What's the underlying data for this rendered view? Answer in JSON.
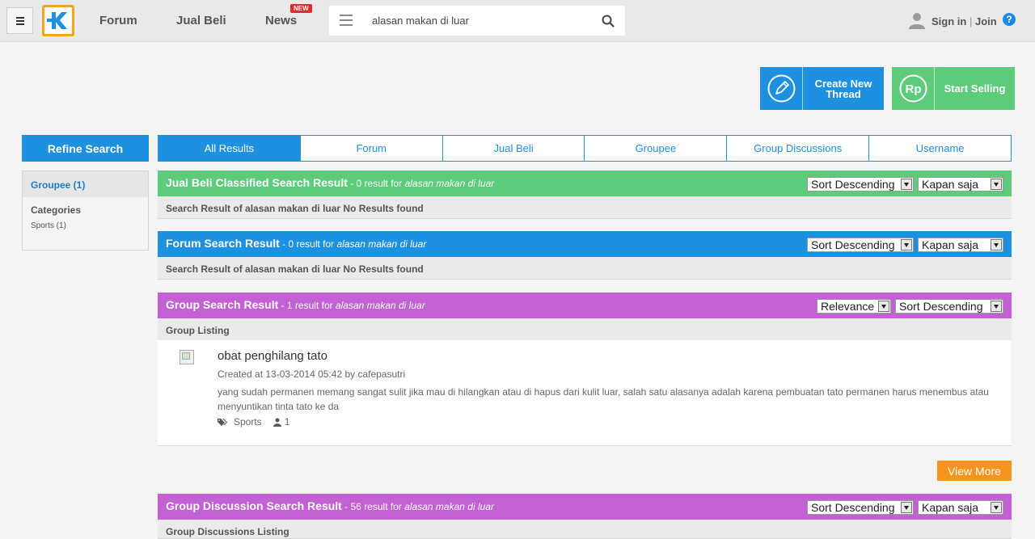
{
  "header": {
    "nav": [
      "Forum",
      "Jual Beli",
      "News"
    ],
    "new_badge": "NEW",
    "search": {
      "value": "alasan makan di luar",
      "placeholder": ""
    },
    "signin": "Sign in",
    "separator": "|",
    "join": "Join",
    "help": "?"
  },
  "actions": {
    "create_line1": "Create New",
    "create_line2": "Thread",
    "sell": "Start Selling",
    "sell_icon_text": "Rp"
  },
  "sidebar": {
    "refine": "Refine Search",
    "groupee": "Groupee (1)",
    "categories": "Categories",
    "sports": "Sports (1)"
  },
  "tabs": [
    "All Results",
    "Forum",
    "Jual Beli",
    "Groupee",
    "Group Discussions",
    "Username"
  ],
  "sections": {
    "jualbeli": {
      "title": "Jual Beli Classified Search Result",
      "count": " - 0 result for ",
      "query": "alasan makan di luar",
      "sort": "Sort Descending",
      "time": "Kapan saja",
      "noresult": "Search Result of alasan makan di luar No Results found"
    },
    "forum": {
      "title": "Forum Search Result",
      "count": " - 0 result for ",
      "query": "alasan makan di luar",
      "sort": "Sort Descending",
      "time": "Kapan saja",
      "noresult": "Search Result of alasan makan di luar No Results found"
    },
    "group": {
      "title": "Group Search Result",
      "count": " - 1 result for ",
      "query": "alasan makan di luar",
      "relevance": "Relevance",
      "sort": "Sort Descending",
      "listing": "Group Listing",
      "item": {
        "title": "obat penghilang tato",
        "meta": "Created at 13-03-2014 05:42 by cafepasutri",
        "desc": "yang sudah permanen memang sangat sulit jika mau di hilangkan atau di hapus dari kulit luar, salah satu alasanya adalah karena pembuatan tato permanen harus menembus atau menyuntikan tinta tato ke da",
        "tag": "Sports",
        "members": "1"
      },
      "viewmore": "View More"
    },
    "groupdisc": {
      "title": "Group Discussion Search Result",
      "count": " - 56 result for ",
      "query": "alasan makan di luar",
      "sort": "Sort Descending",
      "time": "Kapan saja",
      "listing": "Group Discussions Listing"
    }
  },
  "colors": {
    "blue": "#1e90e0",
    "green": "#5ccc7b",
    "purple": "#c260d4",
    "orange": "#f7941d",
    "logo_border": "#f7a21b"
  }
}
